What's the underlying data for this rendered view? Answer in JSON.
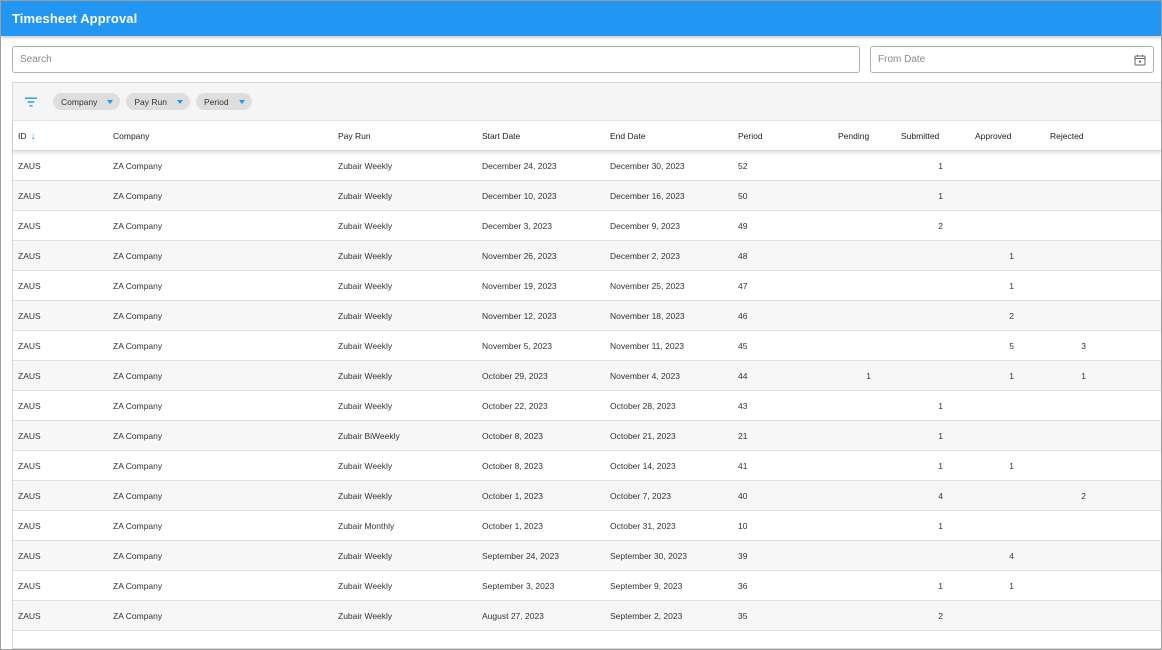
{
  "app": {
    "title": "Timesheet Approval"
  },
  "search": {
    "placeholder": "Search",
    "value": ""
  },
  "from_date": {
    "placeholder": "From Date",
    "value": ""
  },
  "toolbar": {
    "chips": [
      {
        "label": "Company"
      },
      {
        "label": "Pay Run"
      },
      {
        "label": "Period"
      }
    ]
  },
  "columns": {
    "id": "ID",
    "company": "Company",
    "pay_run": "Pay Run",
    "start_date": "Start Date",
    "end_date": "End Date",
    "period": "Period",
    "pending": "Pending",
    "submitted": "Submitted",
    "approved": "Approved",
    "rejected": "Rejected",
    "sort_column": "ID",
    "sort_direction": "descending"
  },
  "colors": {
    "accent": "#2196f3",
    "titlebar": "#2196f3"
  },
  "rows": [
    {
      "id": "ZAUS",
      "company": "ZA Company",
      "pay_run": "Zubair Weekly",
      "start": "December 24, 2023",
      "end": "December 30, 2023",
      "period": "52",
      "pending": "",
      "submitted": "1",
      "approved": "",
      "rejected": ""
    },
    {
      "id": "ZAUS",
      "company": "ZA Company",
      "pay_run": "Zubair Weekly",
      "start": "December 10, 2023",
      "end": "December 16, 2023",
      "period": "50",
      "pending": "",
      "submitted": "1",
      "approved": "",
      "rejected": ""
    },
    {
      "id": "ZAUS",
      "company": "ZA Company",
      "pay_run": "Zubair Weekly",
      "start": "December 3, 2023",
      "end": "December 9, 2023",
      "period": "49",
      "pending": "",
      "submitted": "2",
      "approved": "",
      "rejected": ""
    },
    {
      "id": "ZAUS",
      "company": "ZA Company",
      "pay_run": "Zubair Weekly",
      "start": "November 26, 2023",
      "end": "December 2, 2023",
      "period": "48",
      "pending": "",
      "submitted": "",
      "approved": "1",
      "rejected": ""
    },
    {
      "id": "ZAUS",
      "company": "ZA Company",
      "pay_run": "Zubair Weekly",
      "start": "November 19, 2023",
      "end": "November 25, 2023",
      "period": "47",
      "pending": "",
      "submitted": "",
      "approved": "1",
      "rejected": ""
    },
    {
      "id": "ZAUS",
      "company": "ZA Company",
      "pay_run": "Zubair Weekly",
      "start": "November 12, 2023",
      "end": "November 18, 2023",
      "period": "46",
      "pending": "",
      "submitted": "",
      "approved": "2",
      "rejected": ""
    },
    {
      "id": "ZAUS",
      "company": "ZA Company",
      "pay_run": "Zubair Weekly",
      "start": "November 5, 2023",
      "end": "November 11, 2023",
      "period": "45",
      "pending": "",
      "submitted": "",
      "approved": "5",
      "rejected": "3"
    },
    {
      "id": "ZAUS",
      "company": "ZA Company",
      "pay_run": "Zubair Weekly",
      "start": "October 29, 2023",
      "end": "November 4, 2023",
      "period": "44",
      "pending": "1",
      "submitted": "",
      "approved": "1",
      "rejected": "1"
    },
    {
      "id": "ZAUS",
      "company": "ZA Company",
      "pay_run": "Zubair Weekly",
      "start": "October 22, 2023",
      "end": "October 28, 2023",
      "period": "43",
      "pending": "",
      "submitted": "1",
      "approved": "",
      "rejected": ""
    },
    {
      "id": "ZAUS",
      "company": "ZA Company",
      "pay_run": "Zubair BiWeekly",
      "start": "October 8, 2023",
      "end": "October 21, 2023",
      "period": "21",
      "pending": "",
      "submitted": "1",
      "approved": "",
      "rejected": ""
    },
    {
      "id": "ZAUS",
      "company": "ZA Company",
      "pay_run": "Zubair Weekly",
      "start": "October 8, 2023",
      "end": "October 14, 2023",
      "period": "41",
      "pending": "",
      "submitted": "1",
      "approved": "1",
      "rejected": ""
    },
    {
      "id": "ZAUS",
      "company": "ZA Company",
      "pay_run": "Zubair Weekly",
      "start": "October 1, 2023",
      "end": "October 7, 2023",
      "period": "40",
      "pending": "",
      "submitted": "4",
      "approved": "",
      "rejected": "2"
    },
    {
      "id": "ZAUS",
      "company": "ZA Company",
      "pay_run": "Zubair Monthly",
      "start": "October 1, 2023",
      "end": "October 31, 2023",
      "period": "10",
      "pending": "",
      "submitted": "1",
      "approved": "",
      "rejected": ""
    },
    {
      "id": "ZAUS",
      "company": "ZA Company",
      "pay_run": "Zubair Weekly",
      "start": "September 24, 2023",
      "end": "September 30, 2023",
      "period": "39",
      "pending": "",
      "submitted": "",
      "approved": "4",
      "rejected": ""
    },
    {
      "id": "ZAUS",
      "company": "ZA Company",
      "pay_run": "Zubair Weekly",
      "start": "September 3, 2023",
      "end": "September 9, 2023",
      "period": "36",
      "pending": "",
      "submitted": "1",
      "approved": "1",
      "rejected": ""
    },
    {
      "id": "ZAUS",
      "company": "ZA Company",
      "pay_run": "Zubair Weekly",
      "start": "August 27, 2023",
      "end": "September 2, 2023",
      "period": "35",
      "pending": "",
      "submitted": "2",
      "approved": "",
      "rejected": ""
    }
  ]
}
